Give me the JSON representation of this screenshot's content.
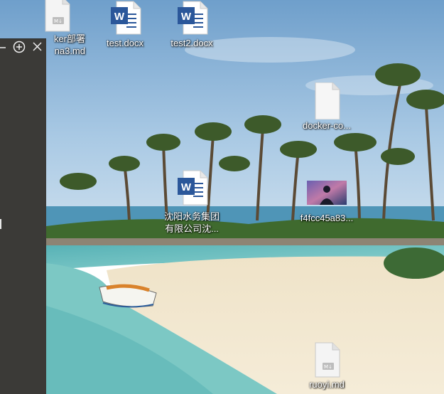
{
  "desktop_icons": [
    {
      "id": "md-top",
      "type": "md",
      "label": "ker部署",
      "label2": "na3.md"
    },
    {
      "id": "test-docx",
      "type": "docx",
      "label": "test.docx"
    },
    {
      "id": "test2-docx",
      "type": "docx",
      "label": "test2.docx"
    },
    {
      "id": "docker-co",
      "type": "blank",
      "label": "docker-co..."
    },
    {
      "id": "shenyang",
      "type": "docx",
      "label": "沈阳水务集团",
      "label2": "有限公司沈..."
    },
    {
      "id": "f4fcc",
      "type": "image",
      "label": "f4fcc45a83..."
    },
    {
      "id": "ruoyi",
      "type": "md",
      "label": "ruoyi.md"
    }
  ],
  "side_panel": {
    "minimize": "–",
    "add": "+",
    "close": "×"
  },
  "colors": {
    "panel": "#3b3a37",
    "word_blue": "#2b579a",
    "sky": "#7eaed6"
  }
}
